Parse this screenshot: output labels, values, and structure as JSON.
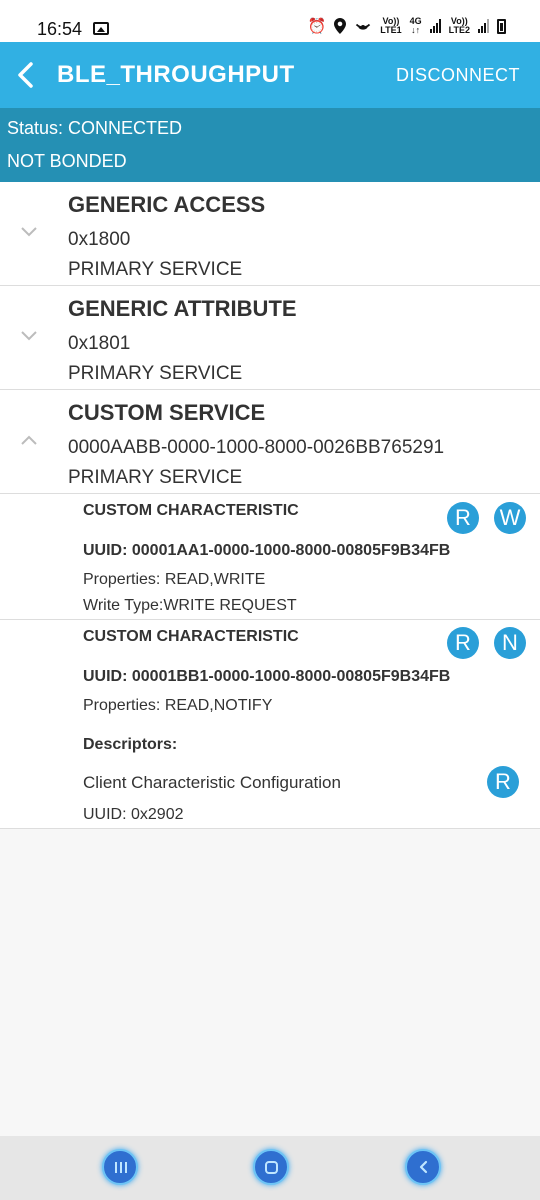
{
  "status_bar": {
    "time": "16:54",
    "sim1_label_top": "Vo))",
    "sim1_label_bottom": "LTE1",
    "network_type": "4G",
    "sim2_label_top": "Vo))",
    "sim2_label_bottom": "LTE2",
    "icons": [
      "image-icon",
      "alarm-icon",
      "location-icon",
      "hotspot-icon",
      "signal-icon",
      "battery-icon"
    ]
  },
  "app_bar": {
    "title": "BLE_THROUGHPUT",
    "action": "DISCONNECT",
    "color": "#31b0e3"
  },
  "connection": {
    "status": "Status: CONNECTED",
    "bond": "NOT BONDED",
    "color": "#2590b4"
  },
  "services": [
    {
      "name": "GENERIC ACCESS",
      "uuid": "0x1800",
      "type": "PRIMARY SERVICE",
      "expanded": false
    },
    {
      "name": "GENERIC ATTRIBUTE",
      "uuid": "0x1801",
      "type": "PRIMARY SERVICE",
      "expanded": false
    },
    {
      "name": "CUSTOM SERVICE",
      "uuid": "0000AABB-0000-1000-8000-0026BB765291",
      "type": "PRIMARY SERVICE",
      "expanded": true
    }
  ],
  "characteristics": [
    {
      "name": "CUSTOM CHARACTERISTIC",
      "uuid": "UUID: 00001AA1-0000-1000-8000-00805F9B34FB",
      "properties": "Properties: READ,WRITE",
      "write_type": "Write Type:WRITE REQUEST",
      "actions": [
        "R",
        "W"
      ]
    },
    {
      "name": "CUSTOM CHARACTERISTIC",
      "uuid": "UUID: 00001BB1-0000-1000-8000-00805F9B34FB",
      "properties": "Properties: READ,NOTIFY",
      "actions": [
        "R",
        "N"
      ],
      "descriptors_label": "Descriptors:",
      "descriptor": {
        "name": "Client Characteristic Configuration",
        "uuid": "UUID: 0x2902",
        "action": "R"
      }
    }
  ],
  "badge_color": "#2a9fd8"
}
